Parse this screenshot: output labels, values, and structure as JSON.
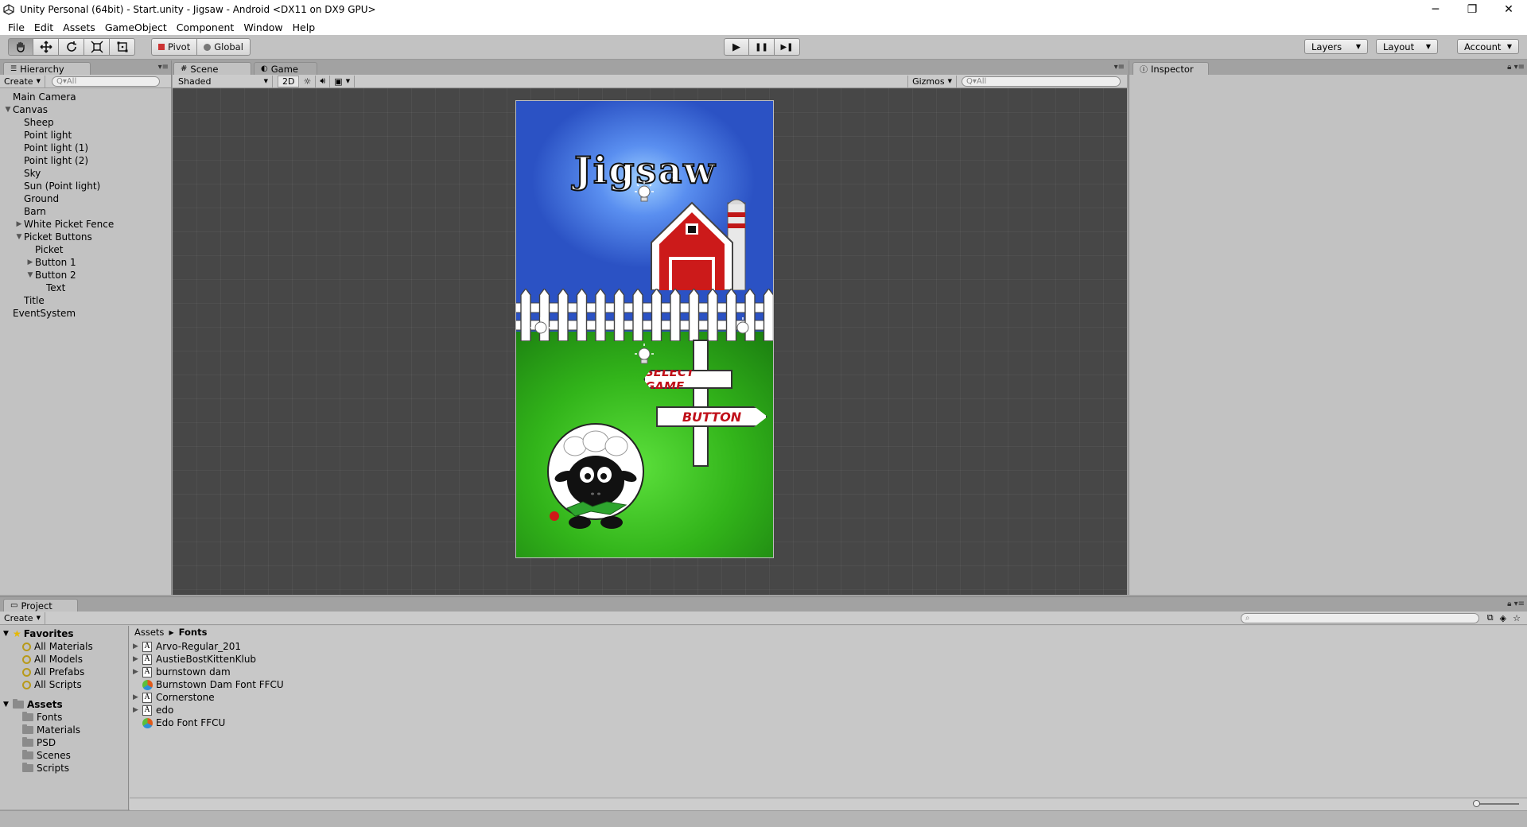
{
  "window": {
    "title": "Unity Personal (64bit) - Start.unity - Jigsaw - Android <DX11 on DX9 GPU>",
    "controls": [
      "─",
      "❐",
      "✕"
    ]
  },
  "menu": [
    "File",
    "Edit",
    "Assets",
    "GameObject",
    "Component",
    "Window",
    "Help"
  ],
  "toolbar": {
    "tools": [
      "hand-icon",
      "move-icon",
      "rotate-icon",
      "scale-icon",
      "rect-icon"
    ],
    "pivot_label": "Pivot",
    "global_label": "Global",
    "play_icons": [
      "▶",
      "❚❚",
      "▶❚"
    ],
    "layers_label": "Layers",
    "layout_label": "Layout",
    "account_label": "Account"
  },
  "hierarchy": {
    "tab": "Hierarchy",
    "create": "Create",
    "search_placeholder": "Q▾All",
    "items": [
      {
        "label": "Main Camera",
        "depth": 0,
        "arrow": ""
      },
      {
        "label": "Canvas",
        "depth": 0,
        "arrow": "▼"
      },
      {
        "label": "Sheep",
        "depth": 1,
        "arrow": ""
      },
      {
        "label": "Point light",
        "depth": 1,
        "arrow": ""
      },
      {
        "label": "Point light (1)",
        "depth": 1,
        "arrow": ""
      },
      {
        "label": "Point light (2)",
        "depth": 1,
        "arrow": ""
      },
      {
        "label": "Sky",
        "depth": 1,
        "arrow": ""
      },
      {
        "label": "Sun (Point light)",
        "depth": 1,
        "arrow": ""
      },
      {
        "label": "Ground",
        "depth": 1,
        "arrow": ""
      },
      {
        "label": "Barn",
        "depth": 1,
        "arrow": ""
      },
      {
        "label": "White Picket Fence",
        "depth": 1,
        "arrow": "▶"
      },
      {
        "label": "Picket Buttons",
        "depth": 1,
        "arrow": "▼"
      },
      {
        "label": "Picket",
        "depth": 2,
        "arrow": ""
      },
      {
        "label": "Button 1",
        "depth": 2,
        "arrow": "▶"
      },
      {
        "label": "Button 2",
        "depth": 2,
        "arrow": "▼"
      },
      {
        "label": "Text",
        "depth": 3,
        "arrow": ""
      },
      {
        "label": "Title",
        "depth": 1,
        "arrow": ""
      },
      {
        "label": "EventSystem",
        "depth": 0,
        "arrow": ""
      }
    ]
  },
  "scene": {
    "tab_scene": "Scene",
    "tab_game": "Game",
    "shading": "Shaded",
    "mode_2d": "2D",
    "gizmos": "Gizmos",
    "search_placeholder": "Q▾All",
    "game": {
      "title": "Jigsaw",
      "sign_select": "SELECT GAME",
      "sign_button": "BUTTON"
    }
  },
  "inspector": {
    "tab": "Inspector"
  },
  "project": {
    "tab": "Project",
    "create": "Create",
    "favorites_label": "Favorites",
    "favorites": [
      "All Materials",
      "All Models",
      "All Prefabs",
      "All Scripts"
    ],
    "assets_label": "Assets",
    "asset_folders": [
      "Fonts",
      "Materials",
      "PSD",
      "Scenes",
      "Scripts"
    ],
    "breadcrumb": [
      "Assets",
      "Fonts"
    ],
    "files": [
      {
        "name": "Arvo-Regular_201",
        "type": "font",
        "expandable": true
      },
      {
        "name": "AustieBostKittenKlub",
        "type": "font",
        "expandable": true
      },
      {
        "name": "burnstown dam",
        "type": "font",
        "expandable": true
      },
      {
        "name": "Burnstown Dam Font FFCU",
        "type": "link",
        "expandable": false
      },
      {
        "name": "Cornerstone",
        "type": "font",
        "expandable": true
      },
      {
        "name": "edo",
        "type": "font",
        "expandable": true
      },
      {
        "name": "Edo Font FFCU",
        "type": "link",
        "expandable": false
      }
    ]
  },
  "colors": {
    "editor_bg": "#c2c2c2",
    "scene_bg": "#474747",
    "sign_text": "#c0101a"
  }
}
